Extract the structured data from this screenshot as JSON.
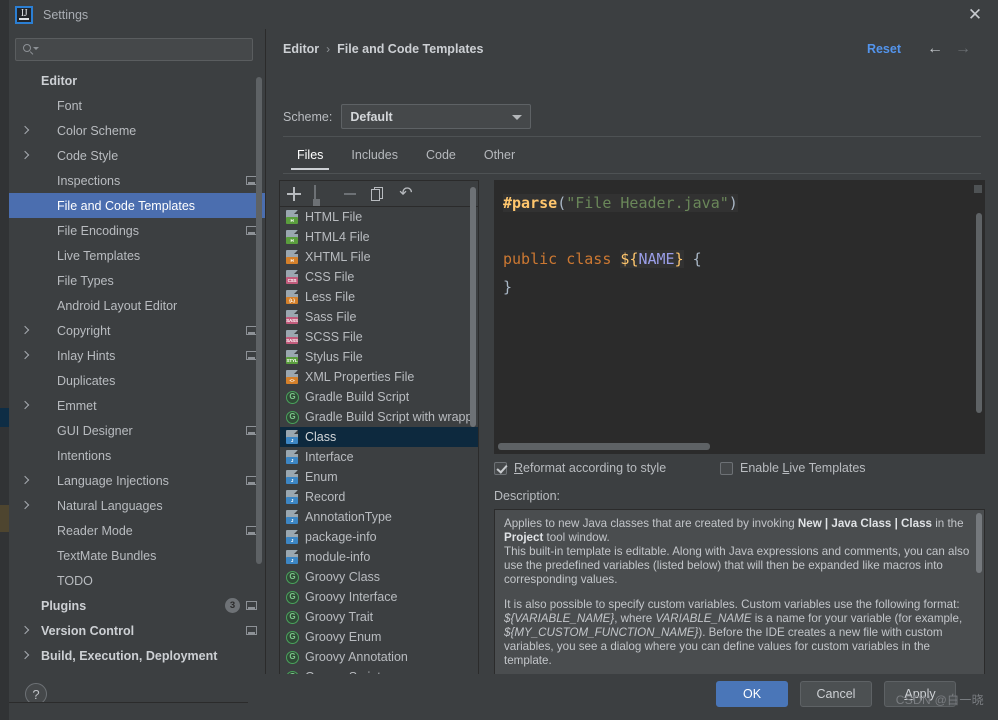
{
  "window": {
    "title": "Settings",
    "logo_text": "IJ",
    "close_icon": "✕"
  },
  "sidebar": {
    "search": {
      "value": "",
      "placeholder": ""
    },
    "scrollbar": "vertical-scrollbar",
    "items": [
      {
        "label": "Editor",
        "indent": 0,
        "bold": true,
        "chevron": false,
        "selected": false,
        "ext": false
      },
      {
        "label": "Font",
        "indent": 1,
        "bold": false,
        "chevron": false,
        "selected": false,
        "ext": false
      },
      {
        "label": "Color Scheme",
        "indent": 1,
        "bold": false,
        "chevron": true,
        "selected": false,
        "ext": false
      },
      {
        "label": "Code Style",
        "indent": 1,
        "bold": false,
        "chevron": true,
        "selected": false,
        "ext": false
      },
      {
        "label": "Inspections",
        "indent": 1,
        "bold": false,
        "chevron": false,
        "selected": false,
        "ext": true
      },
      {
        "label": "File and Code Templates",
        "indent": 1,
        "bold": false,
        "chevron": false,
        "selected": true,
        "ext": false
      },
      {
        "label": "File Encodings",
        "indent": 1,
        "bold": false,
        "chevron": false,
        "selected": false,
        "ext": true
      },
      {
        "label": "Live Templates",
        "indent": 1,
        "bold": false,
        "chevron": false,
        "selected": false,
        "ext": false
      },
      {
        "label": "File Types",
        "indent": 1,
        "bold": false,
        "chevron": false,
        "selected": false,
        "ext": false
      },
      {
        "label": "Android Layout Editor",
        "indent": 1,
        "bold": false,
        "chevron": false,
        "selected": false,
        "ext": false
      },
      {
        "label": "Copyright",
        "indent": 1,
        "bold": false,
        "chevron": true,
        "selected": false,
        "ext": true
      },
      {
        "label": "Inlay Hints",
        "indent": 1,
        "bold": false,
        "chevron": true,
        "selected": false,
        "ext": true
      },
      {
        "label": "Duplicates",
        "indent": 1,
        "bold": false,
        "chevron": false,
        "selected": false,
        "ext": false
      },
      {
        "label": "Emmet",
        "indent": 1,
        "bold": false,
        "chevron": true,
        "selected": false,
        "ext": false
      },
      {
        "label": "GUI Designer",
        "indent": 1,
        "bold": false,
        "chevron": false,
        "selected": false,
        "ext": true
      },
      {
        "label": "Intentions",
        "indent": 1,
        "bold": false,
        "chevron": false,
        "selected": false,
        "ext": false
      },
      {
        "label": "Language Injections",
        "indent": 1,
        "bold": false,
        "chevron": true,
        "selected": false,
        "ext": true
      },
      {
        "label": "Natural Languages",
        "indent": 1,
        "bold": false,
        "chevron": true,
        "selected": false,
        "ext": false
      },
      {
        "label": "Reader Mode",
        "indent": 1,
        "bold": false,
        "chevron": false,
        "selected": false,
        "ext": true
      },
      {
        "label": "TextMate Bundles",
        "indent": 1,
        "bold": false,
        "chevron": false,
        "selected": false,
        "ext": false
      },
      {
        "label": "TODO",
        "indent": 1,
        "bold": false,
        "chevron": false,
        "selected": false,
        "ext": false
      },
      {
        "label": "Plugins",
        "indent": 0,
        "bold": true,
        "chevron": false,
        "selected": false,
        "ext": true,
        "badge": "3"
      },
      {
        "label": "Version Control",
        "indent": 0,
        "bold": true,
        "chevron": true,
        "selected": false,
        "ext": true
      },
      {
        "label": "Build, Execution, Deployment",
        "indent": 0,
        "bold": true,
        "chevron": true,
        "selected": false,
        "ext": false
      }
    ]
  },
  "header": {
    "breadcrumb": [
      "Editor",
      "File and Code Templates"
    ],
    "breadcrumb_separator": "›",
    "reset_label": "Reset",
    "back_arrow": "←",
    "forward_arrow": "→",
    "scheme_label": "Scheme:",
    "scheme_value": "Default"
  },
  "tabs": {
    "active": "Files",
    "items": [
      "Files",
      "Includes",
      "Code",
      "Other"
    ]
  },
  "template_panel": {
    "toolbar": [
      {
        "name": "add-template-button",
        "icon": "plus-icon",
        "enabled": true
      },
      {
        "name": "copy-template-button",
        "icon": "copy-template-icon",
        "enabled": false
      },
      {
        "name": "remove-template-button",
        "icon": "minus-icon",
        "enabled": false
      },
      {
        "name": "duplicate-button",
        "icon": "duplicate-icon",
        "enabled": true
      },
      {
        "name": "reset-template-button",
        "icon": "undo-icon",
        "enabled": true
      }
    ],
    "selected": "Class",
    "items": [
      {
        "label": "HTML File",
        "icon": "file-icon",
        "tag": "H",
        "color": "#5a9e3d"
      },
      {
        "label": "HTML4 File",
        "icon": "file-icon",
        "tag": "H",
        "color": "#5a9e3d"
      },
      {
        "label": "XHTML File",
        "icon": "file-icon",
        "tag": "H",
        "color": "#d4802a"
      },
      {
        "label": "CSS File",
        "icon": "file-icon",
        "tag": "CSS",
        "color": "#c25b7c"
      },
      {
        "label": "Less File",
        "icon": "file-icon",
        "tag": "{L}",
        "color": "#d4802a"
      },
      {
        "label": "Sass File",
        "icon": "file-icon",
        "tag": "SASS",
        "color": "#c25b7c"
      },
      {
        "label": "SCSS File",
        "icon": "file-icon",
        "tag": "SASS",
        "color": "#c25b7c"
      },
      {
        "label": "Stylus File",
        "icon": "file-icon",
        "tag": "STYL",
        "color": "#5a9e3d"
      },
      {
        "label": "XML Properties File",
        "icon": "file-icon",
        "tag": "<>",
        "color": "#d4802a"
      },
      {
        "label": "Gradle Build Script",
        "icon": "groovy-icon"
      },
      {
        "label": "Gradle Build Script with wrapp",
        "icon": "groovy-icon"
      },
      {
        "label": "Class",
        "icon": "java-icon",
        "tag": "J",
        "color": "#3c86c4"
      },
      {
        "label": "Interface",
        "icon": "java-icon",
        "tag": "J",
        "color": "#3c86c4"
      },
      {
        "label": "Enum",
        "icon": "java-icon",
        "tag": "J",
        "color": "#3c86c4"
      },
      {
        "label": "Record",
        "icon": "java-icon",
        "tag": "J",
        "color": "#3c86c4"
      },
      {
        "label": "AnnotationType",
        "icon": "java-icon",
        "tag": "J",
        "color": "#3c86c4"
      },
      {
        "label": "package-info",
        "icon": "java-icon",
        "tag": "J",
        "color": "#3c86c4"
      },
      {
        "label": "module-info",
        "icon": "java-icon",
        "tag": "J",
        "color": "#3c86c4"
      },
      {
        "label": "Groovy Class",
        "icon": "groovy-icon"
      },
      {
        "label": "Groovy Interface",
        "icon": "groovy-icon"
      },
      {
        "label": "Groovy Trait",
        "icon": "groovy-icon"
      },
      {
        "label": "Groovy Enum",
        "icon": "groovy-icon"
      },
      {
        "label": "Groovy Annotation",
        "icon": "groovy-icon"
      },
      {
        "label": "Groovy Script",
        "icon": "groovy-icon"
      }
    ]
  },
  "editor": {
    "code_lines": [
      "#parse(\"File Header.java\")",
      "",
      "public class ${NAME} {",
      "}"
    ],
    "tokens": {
      "parse_directive": "#parse",
      "string_literal": "\"File Header.java\"",
      "keyword_public": "public",
      "keyword_class": "class",
      "variable": "${NAME}",
      "brace_open": "{",
      "brace_close": "}"
    }
  },
  "options": {
    "reformat": {
      "label": "Reformat according to style",
      "mnemonic": "R",
      "checked": true
    },
    "live_templates": {
      "label": "Enable Live Templates",
      "mnemonic": "L",
      "checked": false
    }
  },
  "description": {
    "label": "Description:",
    "paragraphs": [
      "Applies to new Java classes that are created by invoking <b>New | Java Class | Class</b> in the <b>Project</b> tool window.",
      "This built-in template is editable. Along with Java expressions and comments, you can also use the predefined variables (listed below) that will then be expanded like macros into corresponding values.",
      "",
      "It is also possible to specify custom variables. Custom variables use the following format: <i>${VARIABLE_NAME}</i>, where <i>VARIABLE_NAME</i> is a name for your variable (for example, <i>${MY_CUSTOM_FUNCTION_NAME}</i>). Before the IDE creates a new file with custom variables, you see a dialog where you can define values for custom variables in the template."
    ]
  },
  "footer": {
    "help_label": "?",
    "ok_label": "OK",
    "cancel_label": "Cancel",
    "apply_label": "Apply",
    "apply_mnemonic": "A"
  },
  "watermark": "CSDN @白一晓",
  "colors": {
    "accent_blue": "#4b6eaf",
    "link_blue": "#5394ec",
    "primary_button": "#4a76b8",
    "panel_bg": "#3c3f41",
    "editor_bg": "#2b2b2b",
    "list_selected": "#0d293e"
  }
}
